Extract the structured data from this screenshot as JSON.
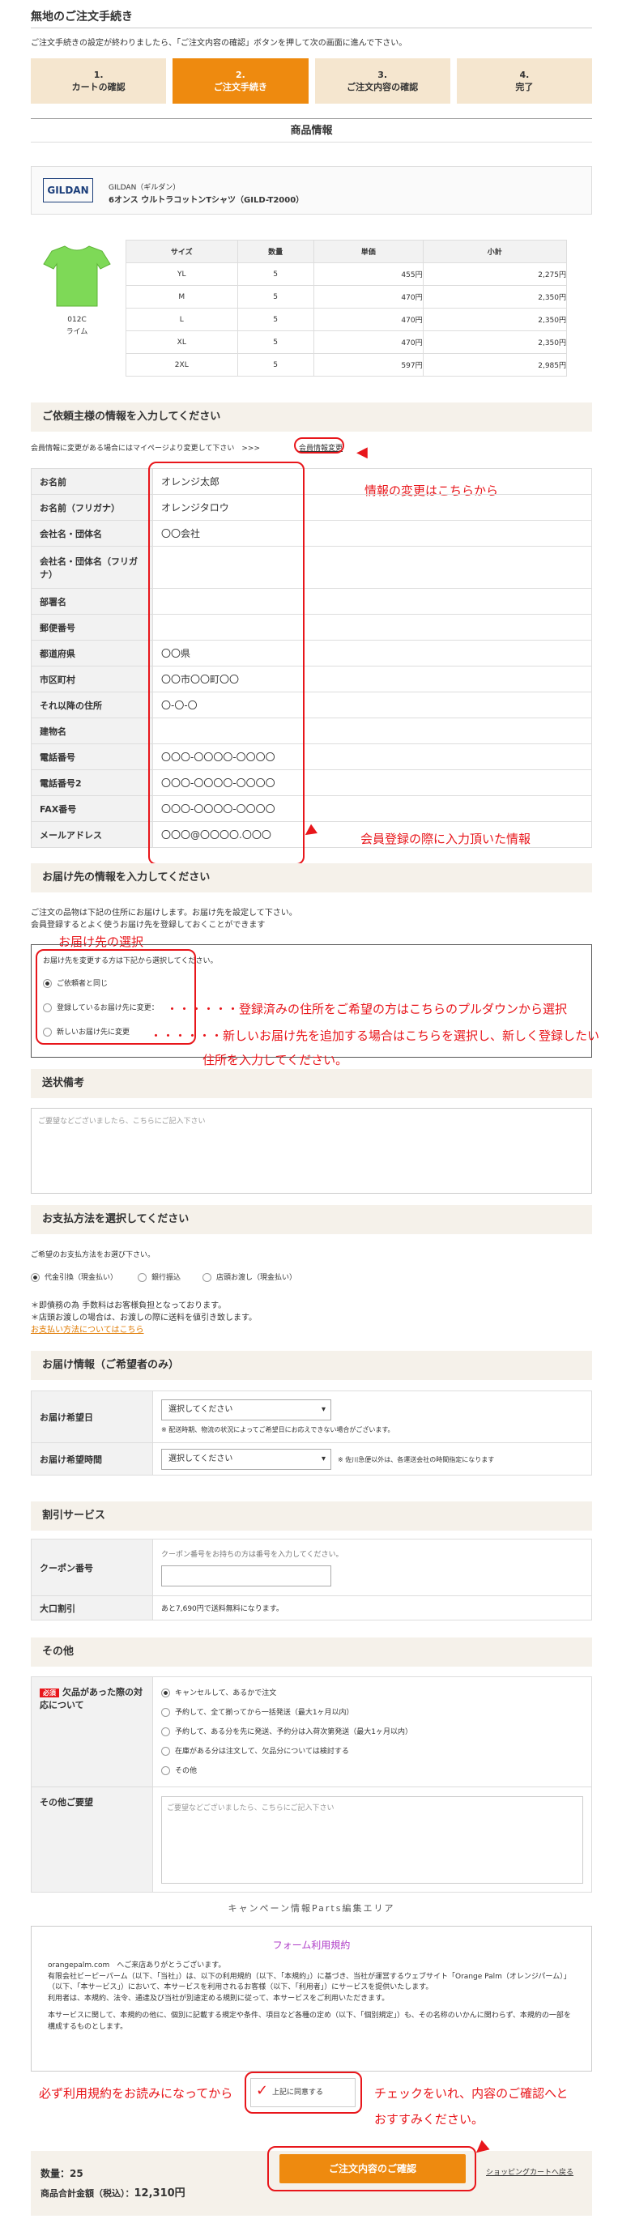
{
  "page": {
    "title": "無地のご注文手続き",
    "intro": "ご注文手続きの設定が終わりましたら、「ご注文内容の確認」ボタンを押して次の画面に進んで下さい。"
  },
  "steps": [
    {
      "num": "1.",
      "label": "カートの確認"
    },
    {
      "num": "2.",
      "label": "ご注文手続き"
    },
    {
      "num": "3.",
      "label": "ご注文内容の確認"
    },
    {
      "num": "4.",
      "label": "完了"
    }
  ],
  "product": {
    "section": "商品情報",
    "logo": "GILDAN",
    "brand": "GILDAN（ギルダン）",
    "name": "6オンス ウルトラコットンTシャツ（GILD-T2000）",
    "color_code": "012C",
    "color_name": "ライム",
    "headers": [
      "サイズ",
      "数量",
      "単価",
      "小計"
    ],
    "rows": [
      [
        "YL",
        "5",
        "455円",
        "2,275円"
      ],
      [
        "M",
        "5",
        "470円",
        "2,350円"
      ],
      [
        "L",
        "5",
        "470円",
        "2,350円"
      ],
      [
        "XL",
        "5",
        "470円",
        "2,350円"
      ],
      [
        "2XL",
        "5",
        "597円",
        "2,985円"
      ]
    ]
  },
  "requester": {
    "section": "ご依頼主様の情報を入力してください",
    "change_note": "会員情報に変更がある場合にはマイページより変更して下さい　>>>",
    "change_link": "会員情報変更",
    "fields": [
      [
        "お名前",
        "オレンジ太郎"
      ],
      [
        "お名前（フリガナ）",
        "オレンジタロウ"
      ],
      [
        "会社名・団体名",
        "〇〇会社"
      ],
      [
        "会社名・団体名（フリガナ）",
        ""
      ],
      [
        "部署名",
        ""
      ],
      [
        "郵便番号",
        ""
      ],
      [
        "都道府県",
        "〇〇県"
      ],
      [
        "市区町村",
        "〇〇市〇〇町〇〇"
      ],
      [
        "それ以降の住所",
        "〇-〇-〇"
      ],
      [
        "建物名",
        ""
      ],
      [
        "電話番号",
        "〇〇〇-〇〇〇〇-〇〇〇〇"
      ],
      [
        "電話番号2",
        "〇〇〇-〇〇〇〇-〇〇〇〇"
      ],
      [
        "FAX番号",
        "〇〇〇-〇〇〇〇-〇〇〇〇"
      ],
      [
        "メールアドレス",
        "〇〇〇@〇〇〇〇.〇〇〇"
      ]
    ]
  },
  "delivery": {
    "section": "お届け先の情報を入力してください",
    "note1": "ご注文の品物は下記の住所にお届けします。お届け先を設定して下さい。",
    "note2": "会員登録するとよく使うお届け先を登録しておくことができます",
    "box_title": "お届け先を変更する方は下記から選択してください。",
    "options": [
      "ご依頼者と同じ",
      "登録しているお届け先に変更：",
      "新しいお届け先に変更"
    ]
  },
  "remarks": {
    "section": "送状備考",
    "placeholder": "ご要望などございましたら、こちらにご記入下さい"
  },
  "payment": {
    "section": "お支払方法を選択してください",
    "prompt": "ご希望のお支払方法をお選び下さい。",
    "options": [
      "代金引換（現金払い）",
      "銀行振込",
      "店頭お渡し（現金払い）"
    ],
    "note1": "＊即債務の為 手数料はお客様負担となっております。",
    "note2": "＊店頭お渡しの場合は、お渡しの際に送料を値引き致します。",
    "link": "お支払い方法についてはこちら"
  },
  "wish": {
    "section": "お届け情報（ご希望者のみ）",
    "date_label": "お届け希望日",
    "date_value": "選択してください",
    "date_note": "※ 配送時期、物流の状況によってご希望日にお応えできない場合がございます。",
    "time_label": "お届け希望時間",
    "time_value": "選択してください",
    "time_note": "※ 佐川急便以外は、各運送会社の時間指定になります"
  },
  "discount": {
    "section": "割引サービス",
    "coupon_label": "クーポン番号",
    "coupon_note": "クーポン番号をお持ちの方は番号を入力してください。",
    "bulk_label": "大口割引",
    "bulk_note": "あと7,690円で送料無料になります。"
  },
  "other": {
    "section": "その他",
    "required": "必須",
    "stock_label": "欠品があった際の対応について",
    "stock_options": [
      "キャンセルして、あるかで注文",
      "予約して、全て揃ってから一括発送（最大1ヶ月以内）",
      "予約して、ある分を先に発送、予約分は入荷次第発送（最大1ヶ月以内）",
      "在庫がある分は注文して、欠品分については検討する",
      "その他"
    ],
    "request_label": "その他ご要望",
    "request_placeholder": "ご要望などございましたら、こちらにご記入下さい"
  },
  "terms": {
    "campaign": "キャンペーン情報Parts編集エリア",
    "title": "フォーム利用規約",
    "p1": "orangepalm.com　へご来店ありがとうございます。",
    "p2": "有限会社ビーピーパーム（以下、「当社」）は、以下の利用規約（以下、「本規約」）に基づき、当社が運営するウェブサイト「Orange Palm（オレンジパーム）」（以下、「本サービス」）において、本サービスを利用されるお客様（以下、「利用者」）にサービスを提供いたします。",
    "p3": "利用者は、本規約、法令、通達及び当社が別途定める規則に従って、本サービスをご利用いただきます。",
    "p4": "本サービスに関して、本規約の他に、個別に記載する規定や条件、項目など各種の定め（以下、「個別規定」）も、その名称のいかんに関わらず、本規約の一部を構成するものとします。",
    "agree": "上記に同意する"
  },
  "footer": {
    "qty_label": "数量：",
    "qty": "25",
    "total_label": "商品合計金額（税込）：",
    "total": "12,310円",
    "confirm": "ご注文内容のご確認",
    "back": "ショッピングカートへ戻る"
  },
  "annotations": {
    "change": "情報の変更はこちらから",
    "member": "会員登録の際に入力頂いた情報",
    "dest": "お届け先の選択",
    "reg1": "・・・・・・登録済みの住所をご希望の方はこちらのプルダウンから選択",
    "new1": "・・・・・・新しいお届け先を追加する場合はこちらを選択し、新しく登録したい",
    "new2": "住所を入力してください。",
    "terms1": "必ず利用規約をお読みになってから",
    "terms2": "チェックをいれ、内容のご確認へと",
    "terms3": "おすすみください。"
  }
}
